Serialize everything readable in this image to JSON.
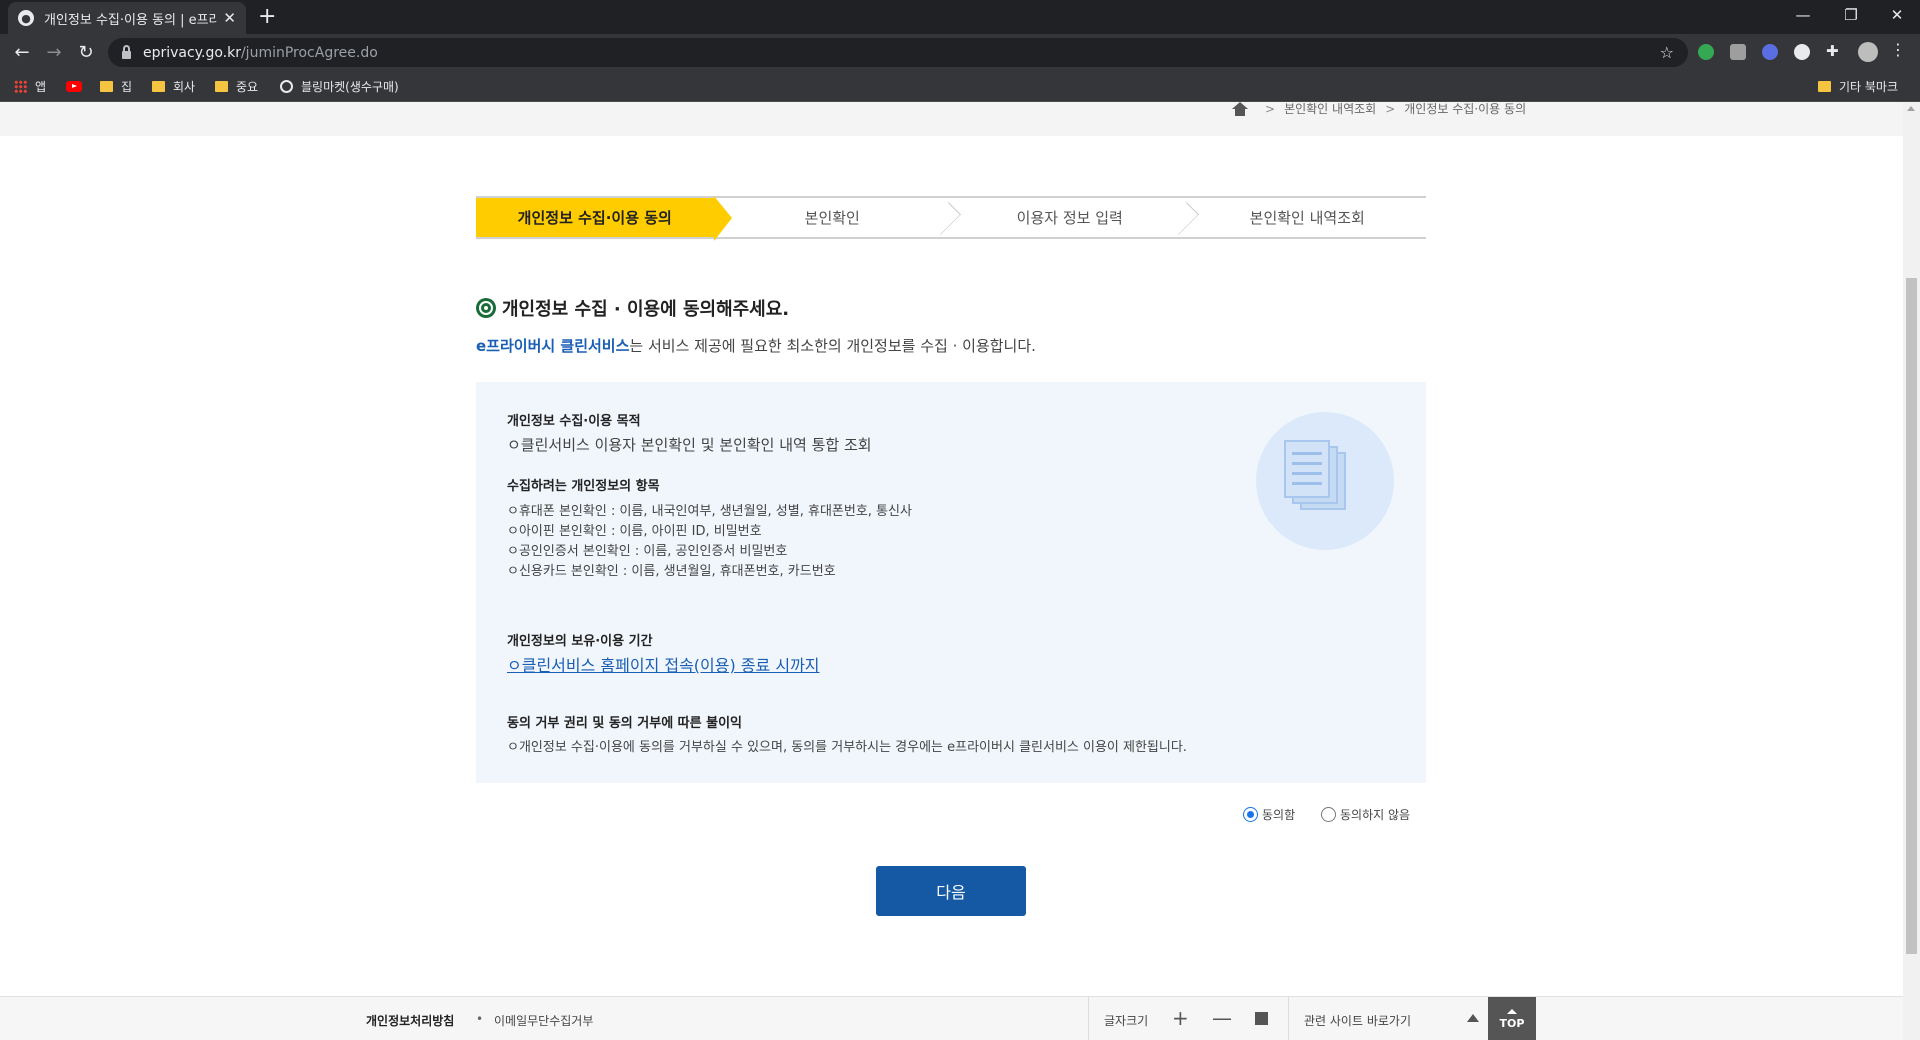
{
  "browser": {
    "tab_title": "개인정보 수집·이용 동의 | e프라이버시 클린서비스",
    "url_host": "eprivacy.go.kr",
    "url_path": "/juminProcAgree.do",
    "bookmarks": [
      "앱",
      "집",
      "회사",
      "중요",
      "블링마켓(생수구매)"
    ],
    "other_bookmarks": "기타 북마크"
  },
  "breadcrumb": [
    "본인확인 내역조회",
    "개인정보 수집·이용 동의"
  ],
  "steps": [
    "개인정보 수집·이용 동의",
    "본인확인",
    "이용자 정보 입력",
    "본인확인 내역조회"
  ],
  "heading": "개인정보 수집 · 이용에 동의해주세요.",
  "intro": {
    "brand": "e프라이버시 클린서비스",
    "text": "는 서비스 제공에 필요한 최소한의 개인정보를 수집 · 이용합니다."
  },
  "info": {
    "purpose_title": "개인정보 수집·이용 목적",
    "purpose_item": "ㅇ클린서비스 이용자 본인확인 및 본인확인 내역 통합 조회",
    "items_title": "수집하려는 개인정보의 항목",
    "items": [
      "ㅇ휴대폰 본인확인 : 이름, 내국인여부, 생년월일, 성별, 휴대폰번호, 통신사",
      "ㅇ아이핀 본인확인 : 이름, 아이핀 ID, 비밀번호",
      "ㅇ공인인증서 본인확인 : 이름, 공인인증서 비밀번호",
      "ㅇ신용카드 본인확인 : 이름, 생년월일, 휴대폰번호, 카드번호"
    ],
    "retention_title": "개인정보의 보유·이용 기간",
    "retention_item": "ㅇ클린서비스 홈페이지 접속(이용) 종료 시까지",
    "refusal_title": "동의 거부 권리 및 동의 거부에 따른 불이익",
    "refusal_item": "ㅇ개인정보 수집·이용에 동의를 거부하실 수 있으며, 동의를 거부하시는 경우에는 e프라이버시 클린서비스 이용이 제한됩니다."
  },
  "consent": {
    "agree_label": "동의함",
    "disagree_label": "동의하지 않음",
    "selected": "agree"
  },
  "next_button": "다음",
  "footer": {
    "privacy_policy": "개인정보처리방침",
    "email_refusal": "이메일무단수집거부",
    "font_size_label": "글자크기",
    "related_sites": "관련 사이트 바로가기",
    "top_label": "TOP"
  }
}
